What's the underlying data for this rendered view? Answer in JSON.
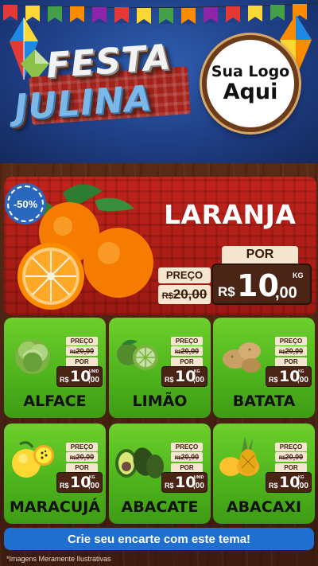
{
  "header": {
    "title_line1": "FESTA",
    "title_line2": "JULINA",
    "logo_placeholder_line1": "Sua Logo",
    "logo_placeholder_line2": "Aqui"
  },
  "hero": {
    "discount": "-50%",
    "name": "LARANJA",
    "old_label": "PREÇO",
    "old_currency": "R$",
    "old_price": "20,00",
    "new_label": "POR",
    "currency": "R$",
    "price_int": "10",
    "price_dec": ",00",
    "unit": "KG"
  },
  "products": [
    {
      "name": "ALFACE",
      "old_label": "PREÇO",
      "old_currency": "R$",
      "old_price": "20,00",
      "new_label": "POR",
      "currency": "R$",
      "price_int": "10",
      "price_dec": ",00",
      "unit": "UNID"
    },
    {
      "name": "LIMÃO",
      "old_label": "PREÇO",
      "old_currency": "R$",
      "old_price": "20,00",
      "new_label": "POR",
      "currency": "R$",
      "price_int": "10",
      "price_dec": ",00",
      "unit": "KG"
    },
    {
      "name": "BATATA",
      "old_label": "PREÇO",
      "old_currency": "R$",
      "old_price": "20,00",
      "new_label": "POR",
      "currency": "R$",
      "price_int": "10",
      "price_dec": ",00",
      "unit": "KG"
    },
    {
      "name": "MARACUJÁ",
      "old_label": "PREÇO",
      "old_currency": "R$",
      "old_price": "20,00",
      "new_label": "POR",
      "currency": "R$",
      "price_int": "10",
      "price_dec": ",00",
      "unit": "KG"
    },
    {
      "name": "ABACATE",
      "old_label": "PREÇO",
      "old_currency": "R$",
      "old_price": "20,00",
      "new_label": "POR",
      "currency": "R$",
      "price_int": "10",
      "price_dec": ",00",
      "unit": "UNID"
    },
    {
      "name": "ABACAXI",
      "old_label": "PREÇO",
      "old_currency": "R$",
      "old_price": "20,00",
      "new_label": "POR",
      "currency": "R$",
      "price_int": "10",
      "price_dec": ",00",
      "unit": "KG"
    }
  ],
  "cta": {
    "label": "Crie seu encarte com este tema!"
  },
  "footnote": "*Imagens Meramente Ilustrativas",
  "colors": {
    "header_blue": "#1f3f86",
    "hero_red": "#b01e17",
    "card_green": "#4db31c",
    "price_brown": "#4a2414",
    "tag_cream": "#f5e6cf",
    "cta_blue": "#1e6fd0"
  },
  "icons": [
    "bunting-flags",
    "paper-lantern-icon",
    "orange-image",
    "lettuce-image",
    "lime-image",
    "potato-image",
    "passion-fruit-image",
    "avocado-image",
    "pineapple-image"
  ]
}
